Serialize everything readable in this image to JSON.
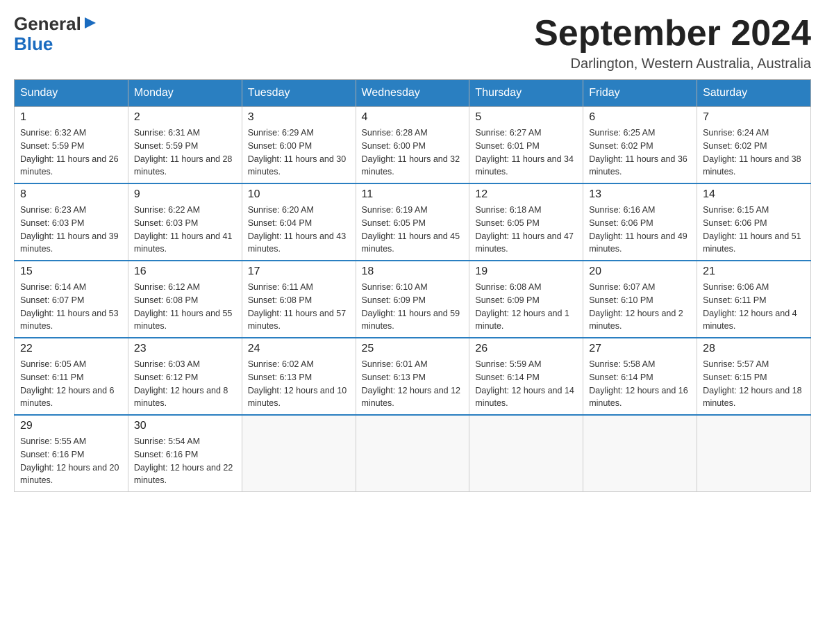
{
  "header": {
    "logo": {
      "general": "General",
      "blue": "Blue"
    },
    "month_title": "September 2024",
    "location": "Darlington, Western Australia, Australia"
  },
  "days_of_week": [
    "Sunday",
    "Monday",
    "Tuesday",
    "Wednesday",
    "Thursday",
    "Friday",
    "Saturday"
  ],
  "weeks": [
    [
      {
        "date": "1",
        "sunrise": "6:32 AM",
        "sunset": "5:59 PM",
        "daylight": "11 hours and 26 minutes."
      },
      {
        "date": "2",
        "sunrise": "6:31 AM",
        "sunset": "5:59 PM",
        "daylight": "11 hours and 28 minutes."
      },
      {
        "date": "3",
        "sunrise": "6:29 AM",
        "sunset": "6:00 PM",
        "daylight": "11 hours and 30 minutes."
      },
      {
        "date": "4",
        "sunrise": "6:28 AM",
        "sunset": "6:00 PM",
        "daylight": "11 hours and 32 minutes."
      },
      {
        "date": "5",
        "sunrise": "6:27 AM",
        "sunset": "6:01 PM",
        "daylight": "11 hours and 34 minutes."
      },
      {
        "date": "6",
        "sunrise": "6:25 AM",
        "sunset": "6:02 PM",
        "daylight": "11 hours and 36 minutes."
      },
      {
        "date": "7",
        "sunrise": "6:24 AM",
        "sunset": "6:02 PM",
        "daylight": "11 hours and 38 minutes."
      }
    ],
    [
      {
        "date": "8",
        "sunrise": "6:23 AM",
        "sunset": "6:03 PM",
        "daylight": "11 hours and 39 minutes."
      },
      {
        "date": "9",
        "sunrise": "6:22 AM",
        "sunset": "6:03 PM",
        "daylight": "11 hours and 41 minutes."
      },
      {
        "date": "10",
        "sunrise": "6:20 AM",
        "sunset": "6:04 PM",
        "daylight": "11 hours and 43 minutes."
      },
      {
        "date": "11",
        "sunrise": "6:19 AM",
        "sunset": "6:05 PM",
        "daylight": "11 hours and 45 minutes."
      },
      {
        "date": "12",
        "sunrise": "6:18 AM",
        "sunset": "6:05 PM",
        "daylight": "11 hours and 47 minutes."
      },
      {
        "date": "13",
        "sunrise": "6:16 AM",
        "sunset": "6:06 PM",
        "daylight": "11 hours and 49 minutes."
      },
      {
        "date": "14",
        "sunrise": "6:15 AM",
        "sunset": "6:06 PM",
        "daylight": "11 hours and 51 minutes."
      }
    ],
    [
      {
        "date": "15",
        "sunrise": "6:14 AM",
        "sunset": "6:07 PM",
        "daylight": "11 hours and 53 minutes."
      },
      {
        "date": "16",
        "sunrise": "6:12 AM",
        "sunset": "6:08 PM",
        "daylight": "11 hours and 55 minutes."
      },
      {
        "date": "17",
        "sunrise": "6:11 AM",
        "sunset": "6:08 PM",
        "daylight": "11 hours and 57 minutes."
      },
      {
        "date": "18",
        "sunrise": "6:10 AM",
        "sunset": "6:09 PM",
        "daylight": "11 hours and 59 minutes."
      },
      {
        "date": "19",
        "sunrise": "6:08 AM",
        "sunset": "6:09 PM",
        "daylight": "12 hours and 1 minute."
      },
      {
        "date": "20",
        "sunrise": "6:07 AM",
        "sunset": "6:10 PM",
        "daylight": "12 hours and 2 minutes."
      },
      {
        "date": "21",
        "sunrise": "6:06 AM",
        "sunset": "6:11 PM",
        "daylight": "12 hours and 4 minutes."
      }
    ],
    [
      {
        "date": "22",
        "sunrise": "6:05 AM",
        "sunset": "6:11 PM",
        "daylight": "12 hours and 6 minutes."
      },
      {
        "date": "23",
        "sunrise": "6:03 AM",
        "sunset": "6:12 PM",
        "daylight": "12 hours and 8 minutes."
      },
      {
        "date": "24",
        "sunrise": "6:02 AM",
        "sunset": "6:13 PM",
        "daylight": "12 hours and 10 minutes."
      },
      {
        "date": "25",
        "sunrise": "6:01 AM",
        "sunset": "6:13 PM",
        "daylight": "12 hours and 12 minutes."
      },
      {
        "date": "26",
        "sunrise": "5:59 AM",
        "sunset": "6:14 PM",
        "daylight": "12 hours and 14 minutes."
      },
      {
        "date": "27",
        "sunrise": "5:58 AM",
        "sunset": "6:14 PM",
        "daylight": "12 hours and 16 minutes."
      },
      {
        "date": "28",
        "sunrise": "5:57 AM",
        "sunset": "6:15 PM",
        "daylight": "12 hours and 18 minutes."
      }
    ],
    [
      {
        "date": "29",
        "sunrise": "5:55 AM",
        "sunset": "6:16 PM",
        "daylight": "12 hours and 20 minutes."
      },
      {
        "date": "30",
        "sunrise": "5:54 AM",
        "sunset": "6:16 PM",
        "daylight": "12 hours and 22 minutes."
      },
      null,
      null,
      null,
      null,
      null
    ]
  ]
}
